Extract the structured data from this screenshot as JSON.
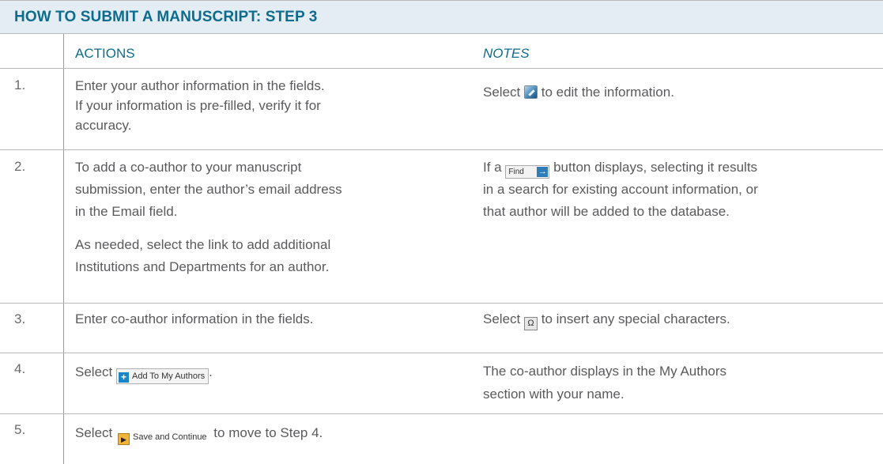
{
  "title": "HOW TO SUBMIT A MANUSCRIPT:  STEP 3",
  "headers": {
    "actions": "ACTIONS",
    "notes": "NOTES"
  },
  "rows": [
    {
      "number": "1.",
      "actions": [
        "Enter your author information in the fields.",
        "If your information is pre-filled, verify it for",
        "accuracy."
      ],
      "notes": {
        "before": "Select",
        "icon": "edit-icon",
        "after": "to edit the information."
      }
    },
    {
      "number": "2.",
      "actions": [
        "To add a co-author to your manuscript",
        "submission, enter the author’s email address",
        "in the Email field.",
        "As needed, select the link to add additional",
        "Institutions and Departments for an author."
      ],
      "notes": {
        "before": "If a",
        "icon": "find-button-icon",
        "icon_label": "Find",
        "after_lines": [
          "button displays, selecting it results",
          "in a search for existing account information, or",
          "that author will be added to the database."
        ]
      }
    },
    {
      "number": "3.",
      "actions": [
        "Enter co-author information in the fields."
      ],
      "notes": {
        "before": "Select",
        "icon": "special-characters-icon",
        "icon_label": "Ω",
        "after": "to insert any special characters."
      }
    },
    {
      "number": "4.",
      "actions": {
        "before": "Select",
        "icon": "add-to-my-authors-button-icon",
        "icon_label": "Add To My Authors",
        "after": "."
      },
      "notes": [
        "The co-author displays in the My Authors",
        "section with your name."
      ]
    },
    {
      "number": "5.",
      "actions": {
        "before": "Select",
        "icon": "save-and-continue-button-icon",
        "icon_label": "Save and Continue",
        "after": "to move to Step 4."
      }
    }
  ],
  "colors": {
    "accent": "#0d6c8e",
    "title_bg": "#e3edf3",
    "text": "#5a5a5c"
  }
}
